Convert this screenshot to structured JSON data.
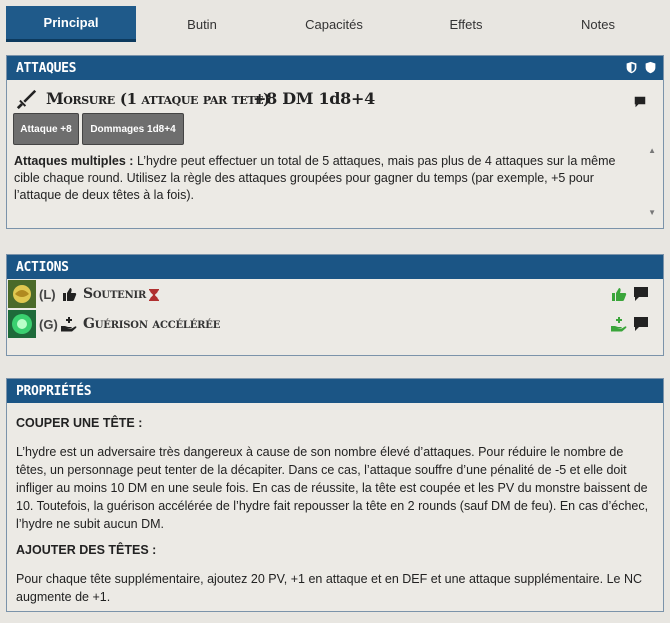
{
  "tabs": [
    {
      "label": "Principal",
      "active": true
    },
    {
      "label": "Butin"
    },
    {
      "label": "Capacités"
    },
    {
      "label": "Effets"
    },
    {
      "label": "Notes"
    }
  ],
  "attacks": {
    "title": "ATTAQUES",
    "attack_name_prefix": "Morsure",
    "attack_name_suffix": "(1 attaque par tete)",
    "attack_stats": "+8 DM 1d8+4",
    "button_attack": "Attaque +8",
    "button_damage": "Dommages 1d8+4",
    "desc_bold": "Attaques multiples :",
    "desc_text": "L’hydre peut effectuer un total de 5 attaques, mais pas plus de 4 attaques sur la même cible chaque round. Utilisez la règle des attaques groupées pour gagner du temps (par exemple, +5 pour l’attaque de deux têtes à la fois)."
  },
  "actions": {
    "title": "ACTIONS",
    "items": [
      {
        "prefix": "(L)",
        "name": "Soutenir"
      },
      {
        "prefix": "(G)",
        "name": "Guérison accélérée"
      }
    ]
  },
  "properties": {
    "title": "PROPRIÉTÉS",
    "section1_title": "COUPER UNE TÊTE :",
    "section1_text": "L’hydre est un adversaire très dangereux à cause de son nombre élevé d’attaques. Pour réduire le nombre de têtes, un personnage peut tenter de la décapiter. Dans ce cas, l’attaque souffre d’une pénalité de -5 et elle doit infliger au moins 10 DM en une seule fois. En cas de réussite, la tête est coupée et les PV du monstre baissent de 10. Toutefois, la guérison accélérée de l’hydre fait repousser la tête en 2 rounds (sauf DM de feu). En cas d’échec, l’hydre ne subit aucun DM.",
    "section2_title": "AJOUTER DES TÊTES :",
    "section2_text": "Pour chaque tête supplémentaire, ajoutez 20 PV, +1 en attaque et en DEF et une attaque supplémentaire. Le NC augmente de +1."
  },
  "colors": {
    "header_blue": "#1b5585",
    "green": "#3aa53a",
    "hourglass": "#b03030"
  }
}
